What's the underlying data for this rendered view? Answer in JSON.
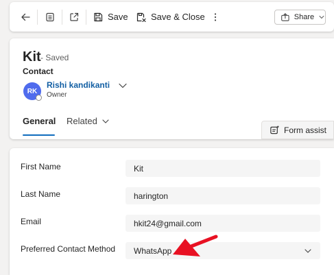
{
  "command_bar": {
    "save_label": "Save",
    "save_close_label": "Save & Close",
    "share_label": "Share",
    "icons": [
      "back-arrow-icon",
      "record-view-icon",
      "open-new-window-icon",
      "save-disk-icon",
      "save-close-icon",
      "more-options-icon",
      "share-icon",
      "chevron-down-icon"
    ]
  },
  "header": {
    "title": "Kit",
    "saved_status": "- Saved",
    "entity": "Contact",
    "owner": {
      "initials": "RK",
      "name": "Rishi kandikanti",
      "role": "Owner",
      "avatar_color": "#4f6bed"
    },
    "tabs": [
      {
        "label": "General",
        "selected": true
      },
      {
        "label": "Related",
        "selected": false
      }
    ],
    "form_assist_label": "Form assist"
  },
  "form": {
    "fields": [
      {
        "label": "First Name",
        "value": "Kit"
      },
      {
        "label": "Last Name",
        "value": "harington"
      },
      {
        "label": "Email",
        "value": "hkit24@gmail.com"
      },
      {
        "label": "Preferred Contact Method",
        "value": "WhatsApp"
      }
    ]
  },
  "colors": {
    "accent": "#0f6cbd",
    "link": "#115ea3",
    "annotation_arrow": "#e81123"
  }
}
